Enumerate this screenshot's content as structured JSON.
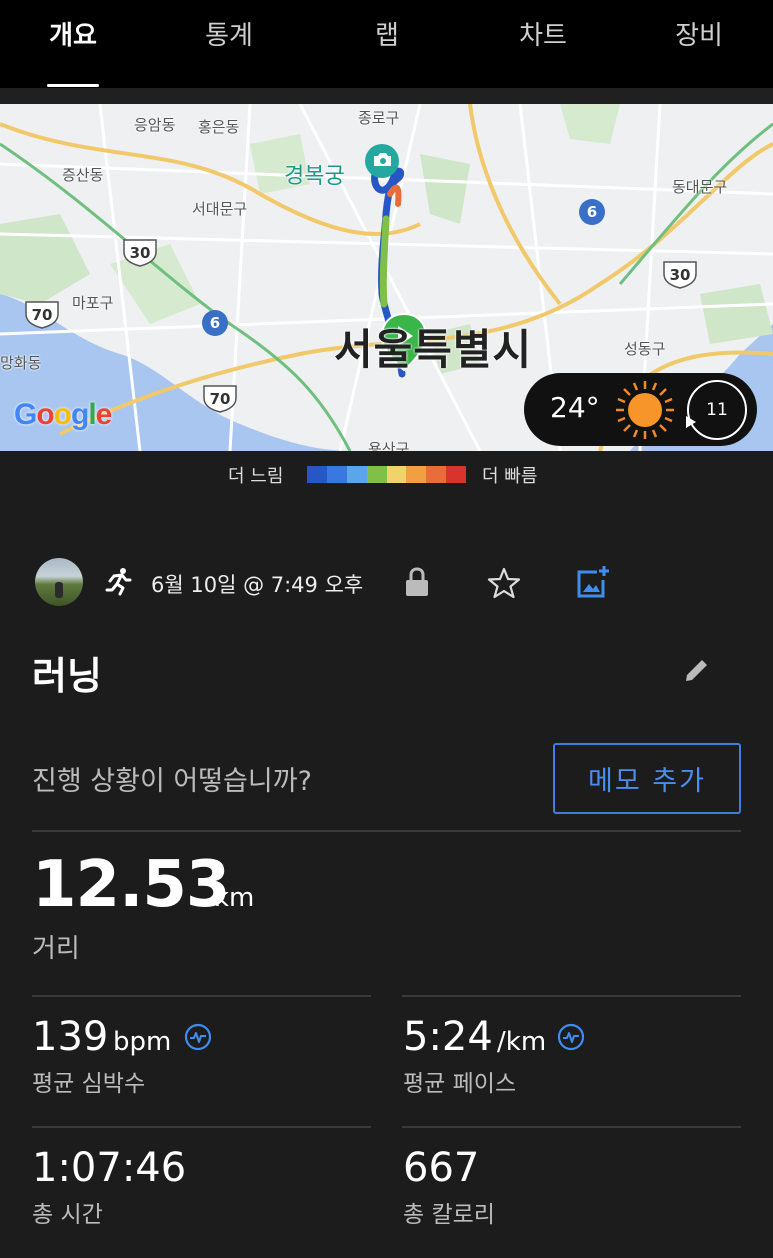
{
  "tabs": [
    {
      "label": "개요",
      "active": true
    },
    {
      "label": "통계",
      "active": false
    },
    {
      "label": "랩",
      "active": false
    },
    {
      "label": "차트",
      "active": false
    },
    {
      "label": "장비",
      "active": false
    }
  ],
  "map": {
    "labels": {
      "eungam": "응암동",
      "hongeun": "홍은동",
      "jongno": "종로구",
      "gyeongbokgung": "경복궁",
      "jeungsan": "증산동",
      "seodaemun": "서대문구",
      "dongdaemun": "동대문구",
      "mapo": "마포구",
      "seoul": "서울특별시",
      "seongdong": "성동구",
      "gonghwa": "망화동",
      "yongsan": "용산구"
    },
    "road_badges": {
      "r30a": "30",
      "r30b": "30",
      "r70a": "70",
      "r70b": "70",
      "r6a": "6",
      "r6b": "6"
    },
    "logo": {
      "g1": "G",
      "o1": "o",
      "o2": "o",
      "g2": "g",
      "l": "l",
      "e": "e"
    },
    "weather": {
      "temperature": "24°",
      "wind_speed": "11",
      "icon": "sun-icon"
    }
  },
  "legend": {
    "slow_label": "더 느림",
    "fast_label": "더 빠름",
    "colors": [
      "#2757c4",
      "#3a78e0",
      "#5aa6e8",
      "#7ec04a",
      "#f2d26a",
      "#f0a040",
      "#e86d3a",
      "#d8342c"
    ]
  },
  "activity": {
    "type_icon": "running-icon",
    "date": "6월 10일 @ 7:49 오후",
    "title": "러닝",
    "prompt": "진행 상황이 어떻습니까?",
    "memo_button": "메모 추가"
  },
  "stats": {
    "distance": {
      "value": "12.53",
      "unit": "km",
      "label": "거리"
    },
    "heart_rate": {
      "value": "139",
      "unit": "bpm",
      "label": "평균 심박수"
    },
    "pace": {
      "value": "5:24",
      "unit": "/km",
      "label": "평균 페이스"
    },
    "time": {
      "value": "1:07:46",
      "label": "총 시간"
    },
    "calories": {
      "value": "667",
      "label": "총 칼로리"
    }
  },
  "colors": {
    "accent": "#3d7fe0",
    "background": "#1c1c1c",
    "tabbar": "#000000"
  }
}
